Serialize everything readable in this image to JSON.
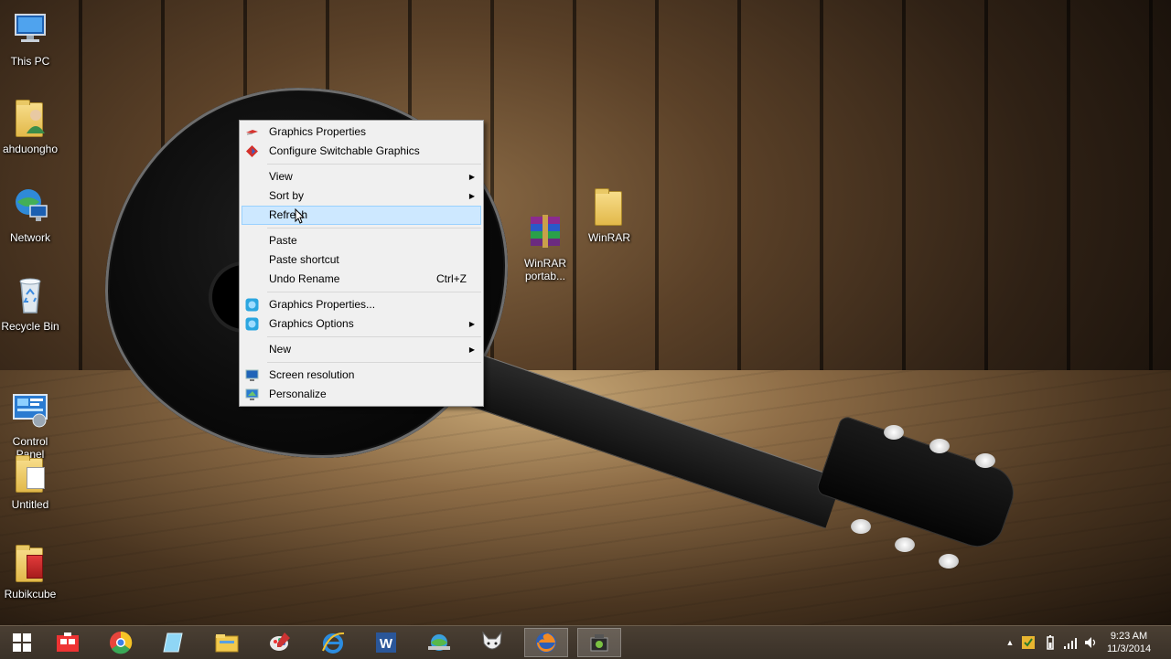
{
  "desktop": {
    "icons": [
      {
        "label": "This PC",
        "icon": "this-pc-icon"
      },
      {
        "label": "ahduongho",
        "icon": "user-folder-icon"
      },
      {
        "label": "Network",
        "icon": "network-icon"
      },
      {
        "label": "Recycle Bin",
        "icon": "recycle-bin-icon"
      },
      {
        "label": "Control\nPanel",
        "icon": "control-panel-icon"
      },
      {
        "label": "Untitled",
        "icon": "folder-icon"
      },
      {
        "label": "Rubikcube",
        "icon": "folder-icon"
      },
      {
        "label": "WinRAR\nportab...",
        "icon": "winrar-icon"
      },
      {
        "label": "WinRAR",
        "icon": "folder-icon"
      }
    ]
  },
  "context_menu": {
    "items": [
      {
        "label": "Graphics Properties",
        "icon": "intel-graphics-icon"
      },
      {
        "label": "Configure Switchable Graphics",
        "icon": "amd-icon"
      },
      {
        "label": "View",
        "submenu": true
      },
      {
        "label": "Sort by",
        "submenu": true
      },
      {
        "label": "Refresh",
        "highlighted": true
      },
      {
        "label": "Paste"
      },
      {
        "label": "Paste shortcut"
      },
      {
        "label": "Undo Rename",
        "shortcut": "Ctrl+Z"
      },
      {
        "label": "Graphics Properties...",
        "icon": "intel-hd-icon"
      },
      {
        "label": "Graphics Options",
        "icon": "intel-hd-icon",
        "submenu": true
      },
      {
        "label": "New",
        "submenu": true
      },
      {
        "label": "Screen resolution",
        "icon": "screen-resolution-icon"
      },
      {
        "label": "Personalize",
        "icon": "personalize-icon"
      }
    ]
  },
  "taskbar": {
    "apps": [
      "start-icon",
      "tile-app-icon",
      "chrome-icon",
      "glass-app-icon",
      "file-explorer-icon",
      "paint-icon",
      "internet-explorer-icon",
      "word-icon",
      "network-app-icon",
      "foxit-icon",
      "firefox-icon",
      "camera-app-icon"
    ],
    "active_apps": [
      "firefox-icon",
      "camera-app-icon"
    ],
    "tray": {
      "chevron": "▲",
      "icons": [
        "security-icon",
        "power-icon",
        "signal-icon",
        "volume-icon"
      ],
      "time": "9:23 AM",
      "date": "11/3/2014"
    }
  },
  "colors": {
    "menu_bg": "#f0f0f0",
    "menu_highlight": "#cde8ff",
    "taskbar": "#3a3128"
  }
}
